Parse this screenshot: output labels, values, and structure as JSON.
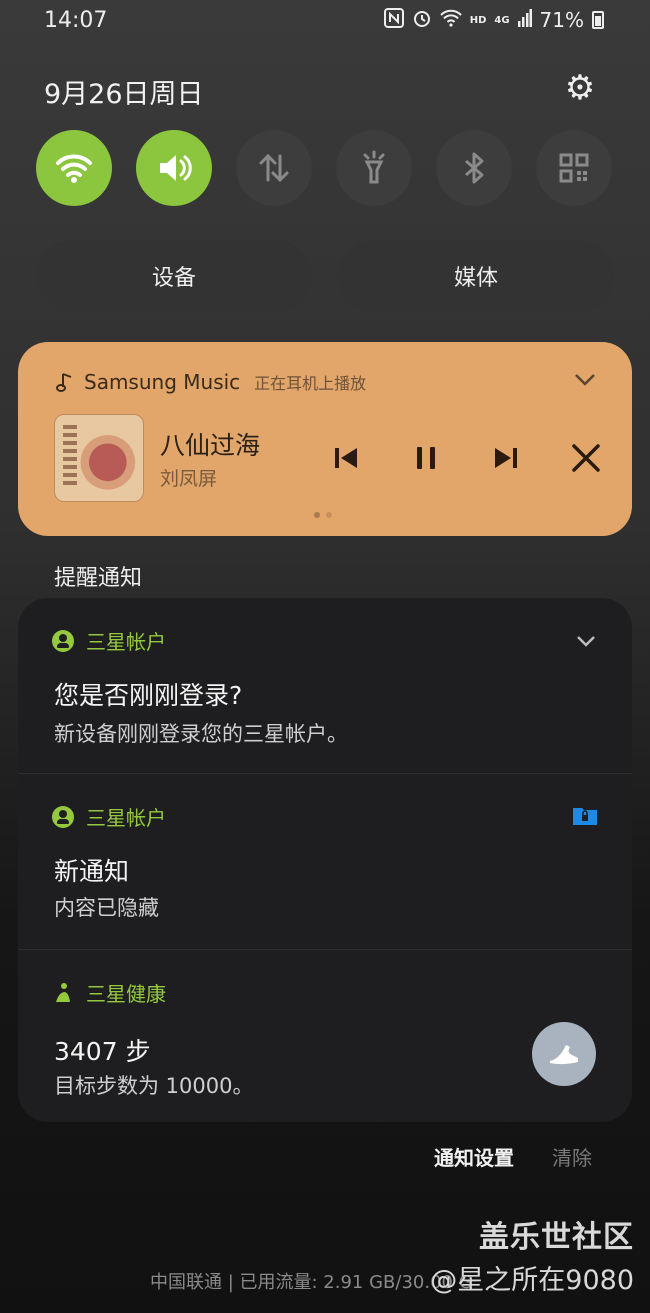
{
  "status_bar": {
    "time": "14:07",
    "signal_label": "4G",
    "hd_label": "HD",
    "battery": "71%"
  },
  "header": {
    "date": "9月26日周日"
  },
  "quick_settings": [
    {
      "name": "wifi",
      "state": "on"
    },
    {
      "name": "sound",
      "state": "on"
    },
    {
      "name": "mobile-data",
      "state": "off"
    },
    {
      "name": "flashlight",
      "state": "off"
    },
    {
      "name": "bluetooth",
      "state": "off"
    },
    {
      "name": "qr-scanner",
      "state": "off"
    }
  ],
  "pills": {
    "devices": "设备",
    "media": "媒体"
  },
  "music": {
    "app": "Samsung Music",
    "status": "正在耳机上播放",
    "song": "八仙过海",
    "artist": "刘凤屏",
    "color": "#e2a66a"
  },
  "section_label": "提醒通知",
  "notifications": [
    {
      "app": "三星帐户",
      "title": "您是否刚刚登录?",
      "body": "新设备刚刚登录您的三星帐户。"
    },
    {
      "app": "三星帐户",
      "title": "新通知",
      "body": "内容已隐藏"
    },
    {
      "app": "三星健康",
      "title": "3407 步",
      "body": "目标步数为 10000。"
    }
  ],
  "footer": {
    "settings_label": "通知设置",
    "clear_label": "清除",
    "carrier_text": "中国联通 | 已用流量: 2.91 GB/30.00 G",
    "watermark": "盖乐世社区",
    "user_mark": "@星之所在9080"
  },
  "colors": {
    "accent_green": "#8cc63f",
    "app_green": "#95c93d",
    "folder_blue": "#1e88e5"
  }
}
